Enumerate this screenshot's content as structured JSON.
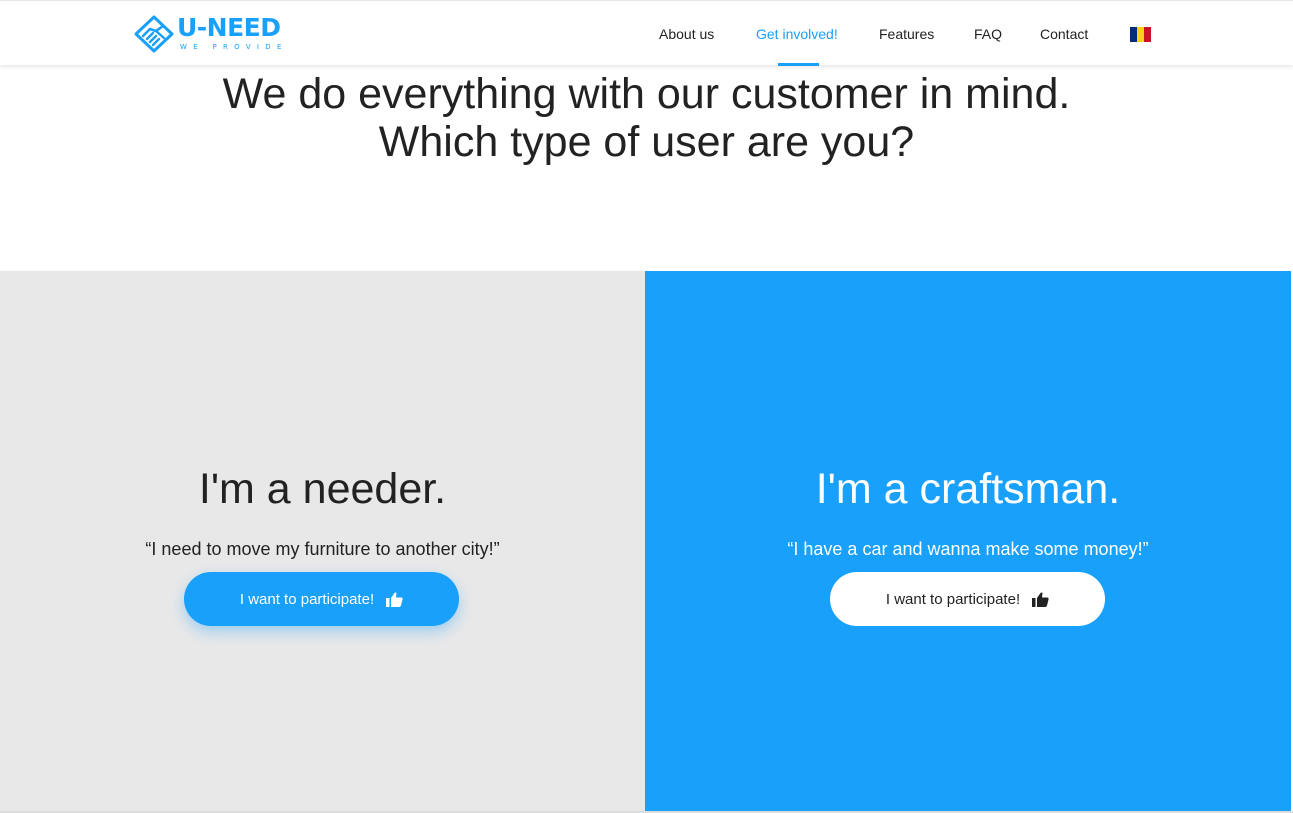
{
  "brand": {
    "name": "U-NEED",
    "tagline": "WE PROVIDE",
    "logo_icon": "handshake-diamond-icon",
    "accent_color": "#18a0fb"
  },
  "nav": {
    "items": [
      {
        "label": "About us"
      },
      {
        "label": "Get involved!",
        "active": true
      },
      {
        "label": "Features"
      },
      {
        "label": "FAQ"
      },
      {
        "label": "Contact"
      }
    ],
    "language_flag": "romania-flag-icon"
  },
  "intro": {
    "line1": "We do everything with our customer in mind.",
    "line2": "Which type of user are you?"
  },
  "needer": {
    "title": "I'm a needer.",
    "quote": "“I need to move my furniture to another city!”",
    "button_label": "I want to participate!",
    "button_icon": "thumbs-up-icon",
    "background": "#e8e8e9"
  },
  "craftsman": {
    "title": "I'm a craftsman.",
    "quote": "“I have a car and wanna make some money!”",
    "button_label": "I want to participate!",
    "button_icon": "thumbs-up-icon",
    "background": "#18a0fb"
  }
}
